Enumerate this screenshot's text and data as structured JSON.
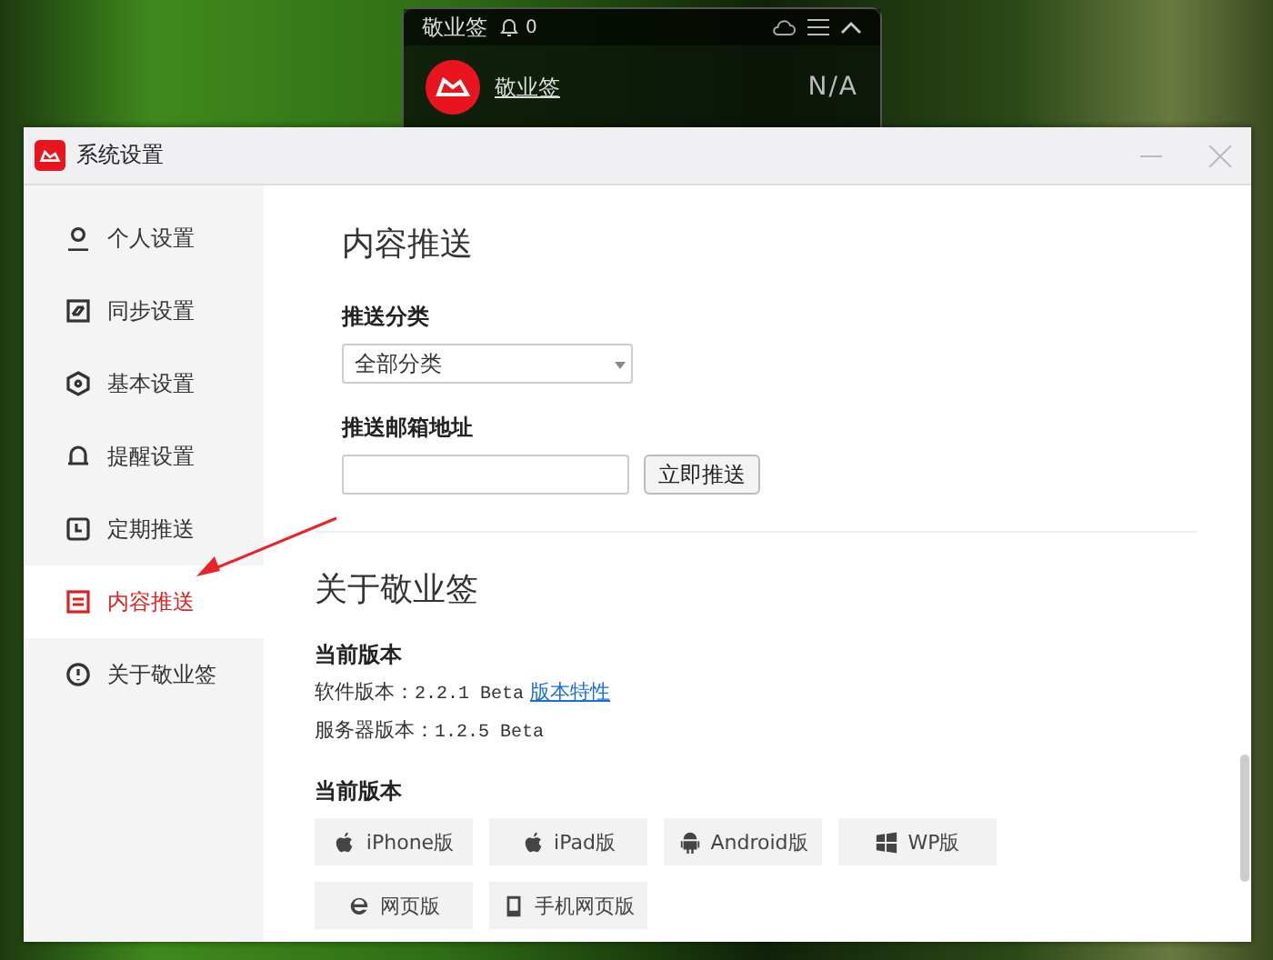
{
  "widget": {
    "title": "敬业签",
    "bell_count": "0",
    "app_name": "敬业签",
    "status": "N/A"
  },
  "window": {
    "title": "系统设置"
  },
  "sidebar": {
    "items": [
      {
        "label": "个人设置",
        "selected": false
      },
      {
        "label": "同步设置",
        "selected": false
      },
      {
        "label": "基本设置",
        "selected": false
      },
      {
        "label": "提醒设置",
        "selected": false
      },
      {
        "label": "定期推送",
        "selected": false
      },
      {
        "label": "内容推送",
        "selected": true
      },
      {
        "label": "关于敬业签",
        "selected": false
      }
    ]
  },
  "push": {
    "heading": "内容推送",
    "category_label": "推送分类",
    "category_value": "全部分类",
    "email_label": "推送邮箱地址",
    "push_button": "立即推送"
  },
  "about": {
    "heading": "关于敬业签",
    "version_heading": "当前版本",
    "software_label": "软件版本：",
    "software_version": "2.2.1 Beta",
    "features_link": "版本特性",
    "server_line": "服务器版本：",
    "server_version": "1.2.5 Beta",
    "download_heading": "当前版本",
    "downloads": [
      "iPhone版",
      "iPad版",
      "Android版",
      "WP版",
      "网页版",
      "手机网页版"
    ]
  }
}
